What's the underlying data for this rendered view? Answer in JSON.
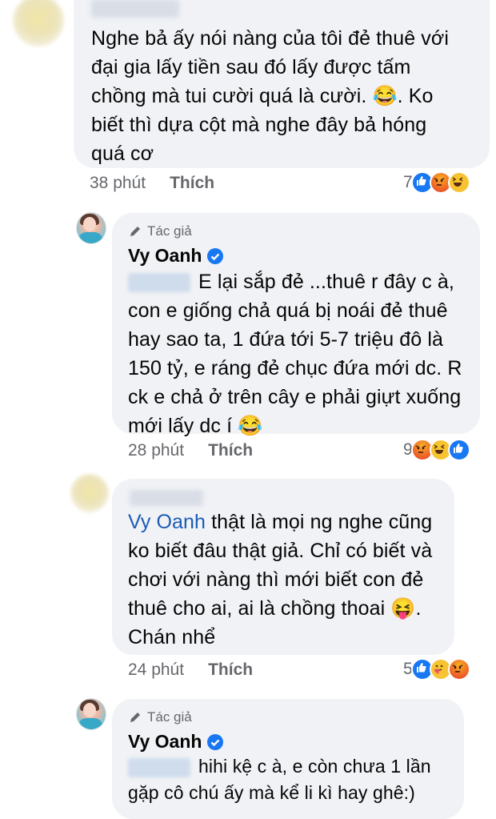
{
  "comments": [
    {
      "text": "Nghe bả ấy nói nàng của tôi đẻ thuê với đại gia lấy tiền sau đó lấy được tấm chồng mà tui cười quá là cười. 😂. Ko biết thì dựa cột mà nghe đây bả hóng quá cơ",
      "lines": [
        "Nghe bả ấy nói nàng của tôi đẻ thuê với",
        "đại gia lấy tiền sau đó lấy được tấm",
        "chồng mà tui cười quá là cười. 😂. Ko",
        "biết thì dựa cột mà nghe đây bả hóng",
        "quá cơ"
      ],
      "time": "38 phút",
      "like_label": "Thích",
      "reaction_count": "7",
      "reactions": [
        "like",
        "angry",
        "haha"
      ]
    },
    {
      "author_tag": "Tác giả",
      "author": "Vy Oanh",
      "verified": true,
      "lines": [
        "E lại sắp đẻ ...thuê r đây c à,",
        "con e giống chả quá bị noái đẻ thuê",
        "hay sao ta, 1 đứa tới 5-7 triệu đô là",
        "150 tỷ, e ráng đẻ chục đứa mới dc. R",
        "ck e chả ở trên cây e phải giựt xuống",
        "mới lấy dc í 😂"
      ],
      "time": "28 phút",
      "like_label": "Thích",
      "reaction_count": "9",
      "reactions": [
        "angry",
        "haha",
        "like"
      ]
    },
    {
      "mention": "Vy Oanh",
      "lines": [
        " thật là mọi ng nghe cũng",
        "ko biết đâu thật giả. Chỉ có biết và",
        "chơi với nàng thì mới biết con đẻ",
        "thuê cho ai, ai là chồng thoai 😝.",
        "Chán nhể"
      ],
      "time": "24 phút",
      "like_label": "Thích",
      "reaction_count": "5",
      "reactions": [
        "like",
        "care",
        "angry"
      ]
    },
    {
      "author_tag": "Tác giả",
      "author": "Vy Oanh",
      "verified": true,
      "lines": [
        "hihi kệ c à, e còn chưa 1 lần",
        "gặp cô chú ấy mà kể li kì hay ghê:)"
      ]
    }
  ],
  "colors": {
    "bubble": "#f0f2f5",
    "meta_text": "#65676b",
    "mention": "#1a5bb7",
    "like_blue": "#1877f2"
  }
}
